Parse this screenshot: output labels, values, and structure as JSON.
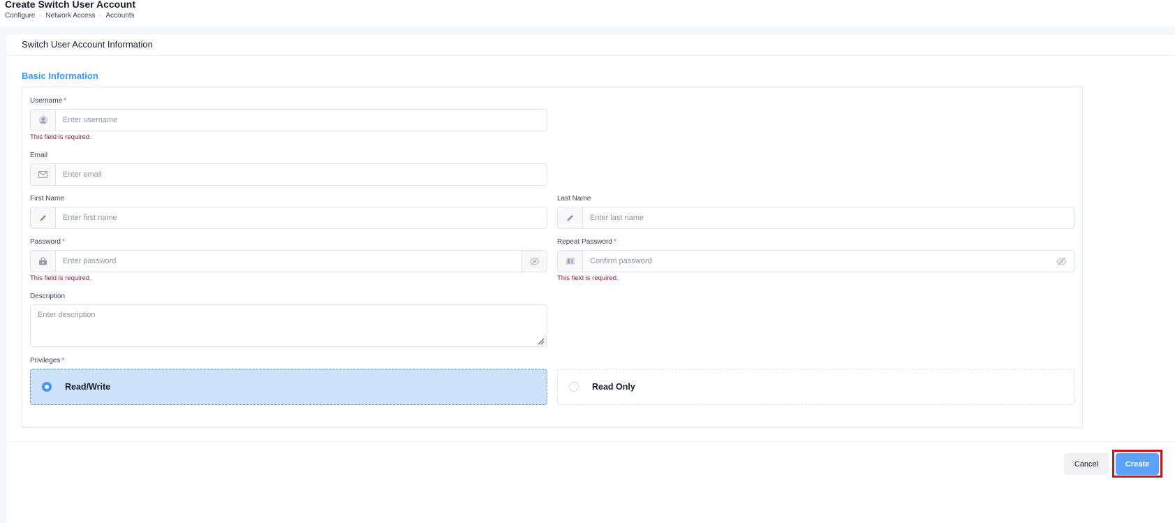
{
  "header": {
    "title": "Create Switch User Account",
    "breadcrumb": [
      "Configure",
      "Network Access",
      "Accounts"
    ],
    "breadcrumb_separator": "-"
  },
  "card": {
    "title": "Switch User Account Information",
    "section_title": "Basic Information"
  },
  "form": {
    "username": {
      "label": "Username",
      "required_mark": "*",
      "placeholder": "Enter username",
      "value": "",
      "error": "This field is required.",
      "icon": "user-avatar-icon"
    },
    "email": {
      "label": "Email",
      "placeholder": "Enter email",
      "value": "",
      "icon": "envelope-icon"
    },
    "first_name": {
      "label": "First Name",
      "placeholder": "Enter first name",
      "value": "",
      "icon": "pencil-icon"
    },
    "last_name": {
      "label": "Last Name",
      "placeholder": "Enter last name",
      "value": "",
      "icon": "pencil-icon"
    },
    "password": {
      "label": "Password",
      "required_mark": "*",
      "placeholder": "Enter password",
      "value": "",
      "error": "This field is required.",
      "icon": "lock-icon",
      "toggle_icon": "eye-slash-icon"
    },
    "repeat_password": {
      "label": "Repeat Password",
      "required_mark": "*",
      "placeholder": "Confirm password",
      "value": "",
      "error": "This field is required.",
      "icon": "password-check-icon",
      "toggle_icon": "eye-slash-icon"
    },
    "description": {
      "label": "Description",
      "placeholder": "Enter description",
      "value": ""
    },
    "privileges": {
      "label": "Privileges",
      "required_mark": "*",
      "options": [
        {
          "label": "Read/Write",
          "selected": true
        },
        {
          "label": "Read Only",
          "selected": false
        }
      ]
    }
  },
  "actions": {
    "cancel_label": "Cancel",
    "create_label": "Create"
  },
  "colors": {
    "accent": "#3e97ff",
    "required": "#f1416c",
    "error_text": "#7e1f3a",
    "selected_bg": "#cfe2fb",
    "create_button": "#5ca2fd",
    "highlight_border": "#c4161c"
  }
}
